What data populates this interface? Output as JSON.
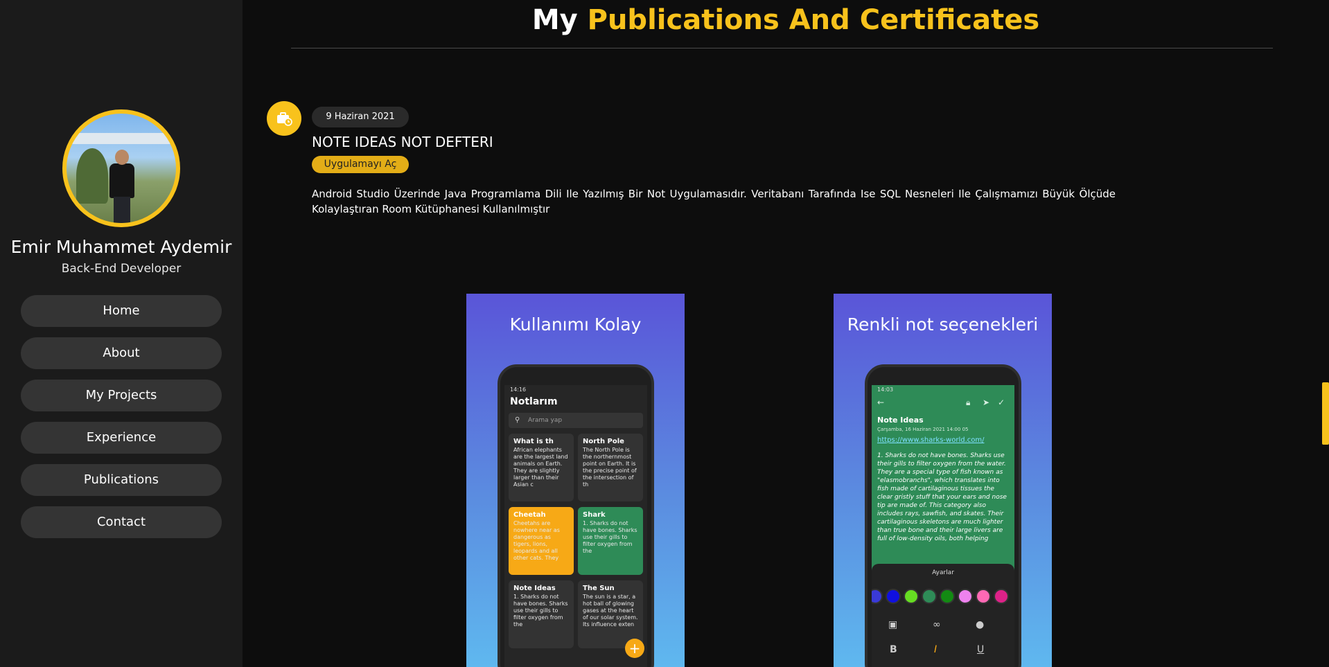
{
  "profile": {
    "name": "Emir Muhammet Aydemir",
    "role": "Back-End Developer"
  },
  "nav": [
    "Home",
    "About",
    "My Projects",
    "Experience",
    "Publications",
    "Contact"
  ],
  "page": {
    "title_plain": "My",
    "title_highlight": "Publications And Certificates"
  },
  "entry": {
    "date": "9 Haziran 2021",
    "title": "NOTE IDEAS NOT DEFTERI",
    "open_button": "Uygulamayı Aç",
    "description": "Android Studio Üzerinde Java Programlama Dili Ile Yazılmış Bir Not Uygulamasıdır. Veritabanı Tarafında Ise SQL Nesneleri Ile Çalışmamızı Büyük Ölçüde Kolaylaştıran Room Kütüphanesi Kullanılmıştır"
  },
  "screenshots": [
    {
      "caption": "Kullanımı Kolay",
      "time": "14:16",
      "app_title": "Notlarım",
      "search_placeholder": "Arama yap",
      "notes": [
        {
          "title": "What is th",
          "body": "African elephants are the largest land animals on Earth. They are slightly larger than their Asian c"
        },
        {
          "title": "North Pole",
          "body": "The North Pole is the northernmost point on Earth. It is the precise point of the intersection of th"
        },
        {
          "title": "Cheetah",
          "body": "Cheetahs are nowhere near as dangerous as tigers, lions, leopards and all other cats. They"
        },
        {
          "title": "Shark",
          "body": "1. Sharks do not have bones. Sharks use their gills to filter oxygen from the"
        },
        {
          "title": "Note Ideas",
          "body": "1. Sharks do not have bones. Sharks use their gills to filter oxygen from the"
        },
        {
          "title": "The Sun",
          "body": "The sun is a star, a hot ball of glowing gases at the heart of our solar system. Its influence exten"
        }
      ],
      "fab": "+"
    },
    {
      "caption": "Renkli not seçenekleri",
      "time": "14:03",
      "note_title": "Note Ideas",
      "note_date": "Çarşamba, 16 Haziran 2021 14:00 05",
      "note_link": "https://www.sharks-world.com/",
      "note_text": "1. Sharks do not have bones. Sharks use their gills to filter oxygen from the water. They are a special type of fish known as \"elasmobranchs\", which translates into fish made of cartilaginous tissues the clear gristly stuff that your ears and nose tip are made of. This category also includes rays, sawfish, and skates. Their cartilaginous skeletons are much lighter than true bone and their large livers are full of low-density oils, both helping",
      "sheet_title": "Ayarlar",
      "swatch_colors": [
        "#3a3ad8",
        "#1010e0",
        "#66dd22",
        "#2e8b57",
        "#138a13",
        "#ee82ee",
        "#ff69b4",
        "#dd2288"
      ]
    }
  ],
  "colors": {
    "accent": "#f8c21c",
    "sidebar_bg": "#1b1b1b",
    "page_bg": "#0d0d0d"
  }
}
